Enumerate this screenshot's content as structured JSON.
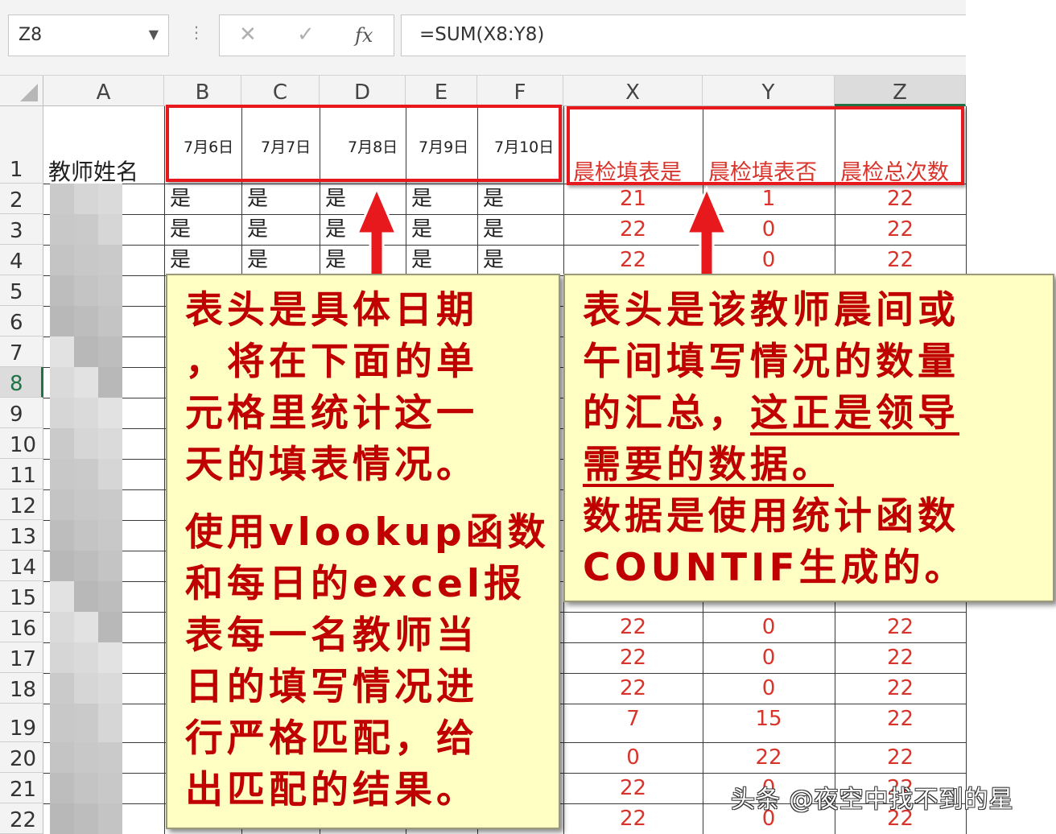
{
  "formula_bar": {
    "name_box": "Z8",
    "cancel": "✕",
    "enter": "✓",
    "fx": "fx",
    "formula": "=SUM(X8:Y8)"
  },
  "columns": [
    "A",
    "B",
    "C",
    "D",
    "E",
    "F",
    "X",
    "Y",
    "Z"
  ],
  "row_numbers": [
    "1",
    "2",
    "3",
    "4",
    "5",
    "6",
    "7",
    "8",
    "9",
    "10",
    "11",
    "12",
    "13",
    "14",
    "15",
    "16",
    "17",
    "18",
    "19",
    "20",
    "21",
    "22"
  ],
  "header_row": {
    "name": "教师姓名",
    "dates": [
      "7月6日",
      "7月7日",
      "7月8日",
      "7月9日",
      "7月10日"
    ],
    "summary": [
      "晨检填表是",
      "晨检填表否",
      "晨检总次数"
    ]
  },
  "yes_value": "是",
  "summary_rows": {
    "r2": [
      "21",
      "1",
      "22"
    ],
    "r3": [
      "22",
      "0",
      "22"
    ],
    "r4": [
      "22",
      "0",
      "22"
    ],
    "r16": [
      "22",
      "0",
      "22"
    ],
    "r17": [
      "22",
      "0",
      "22"
    ],
    "r18": [
      "22",
      "0",
      "22"
    ],
    "r19": [
      "7",
      "15",
      "22"
    ],
    "r20": [
      "0",
      "22",
      "22"
    ],
    "r21": [
      "22",
      "0",
      "22"
    ],
    "r22": [
      "22",
      "0",
      "22"
    ]
  },
  "callout_left": {
    "p1": [
      "表头是具体日期",
      "，将在下面的单",
      "元格里统计这一",
      "天的填表情况。"
    ],
    "p2": [
      "使用vlookup函数",
      "和每日的excel报",
      "表每一名教师当",
      "日的填写情况进",
      "行严格匹配，给",
      "出匹配的结果。"
    ]
  },
  "callout_right": {
    "line1": "表头是该教师晨间或",
    "line2": "午间填写情况的数量",
    "line3a": "的汇总，",
    "line3b": "这正是领导",
    "line4": "需要的数据。",
    "line5": "数据是使用统计函数",
    "line6a": "COUNTIF",
    "line6b": "生成的。"
  },
  "watermark": "头条 @夜空中找不到的星",
  "colors": {
    "accent_red": "#e8191c",
    "callout_bg": "#ffffc4",
    "text_red": "#c00000",
    "excel_green": "#217346"
  }
}
